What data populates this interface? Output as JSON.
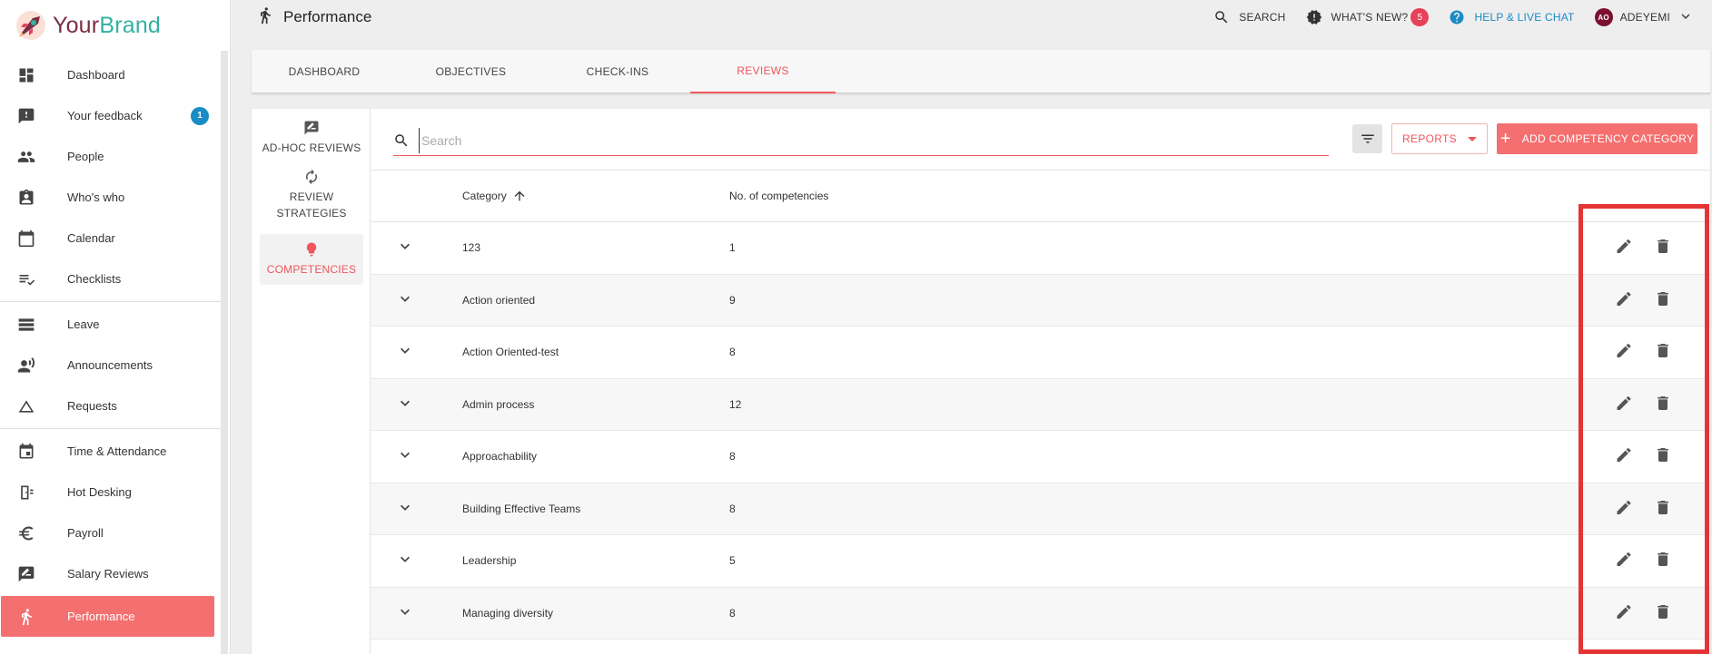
{
  "brand": {
    "name_part1": "Your",
    "name_part2": "Brand"
  },
  "sidebar": {
    "items": [
      {
        "label": "Dashboard",
        "icon": "dashboard-icon"
      },
      {
        "label": "Your feedback",
        "icon": "feedback-icon",
        "badge": "1"
      },
      {
        "label": "People",
        "icon": "people-icon"
      },
      {
        "label": "Who's who",
        "icon": "badge-icon"
      },
      {
        "label": "Calendar",
        "icon": "calendar-icon"
      },
      {
        "label": "Checklists",
        "icon": "checklist-icon"
      },
      {
        "label": "Leave",
        "icon": "leave-icon"
      },
      {
        "label": "Announcements",
        "icon": "announcement-icon"
      },
      {
        "label": "Requests",
        "icon": "triangle-icon"
      },
      {
        "label": "Time & Attendance",
        "icon": "event-icon"
      },
      {
        "label": "Hot Desking",
        "icon": "door-icon"
      },
      {
        "label": "Payroll",
        "icon": "euro-icon"
      },
      {
        "label": "Salary Reviews",
        "icon": "rate-review-icon"
      },
      {
        "label": "Performance",
        "icon": "running-icon",
        "active": true
      }
    ]
  },
  "header": {
    "title": "Performance",
    "search_label": "SEARCH",
    "whats_new_label": "WHAT'S NEW?",
    "whats_new_count": "5",
    "help_label": "HELP & LIVE CHAT",
    "user_initials": "AO",
    "user_name": "ADEYEMI"
  },
  "tabs": [
    {
      "label": "DASHBOARD"
    },
    {
      "label": "OBJECTIVES"
    },
    {
      "label": "CHECK-INS"
    },
    {
      "label": "REVIEWS",
      "active": true
    }
  ],
  "subnav": [
    {
      "label": "AD-HOC REVIEWS"
    },
    {
      "label": "REVIEW STRATEGIES"
    },
    {
      "label": "COMPETENCIES",
      "active": true
    }
  ],
  "toolbar": {
    "search_placeholder": "Search",
    "reports_label": "REPORTS",
    "add_label": "ADD COMPETENCY CATEGORY"
  },
  "table": {
    "col_category": "Category",
    "col_count": "No. of competencies",
    "rows": [
      {
        "category": "123",
        "count": "1"
      },
      {
        "category": "Action oriented",
        "count": "9"
      },
      {
        "category": "Action Oriented-test",
        "count": "8"
      },
      {
        "category": "Admin process",
        "count": "12"
      },
      {
        "category": "Approachability",
        "count": "8"
      },
      {
        "category": "Building Effective Teams",
        "count": "8"
      },
      {
        "category": "Leadership",
        "count": "5"
      },
      {
        "category": "Managing diversity",
        "count": "8"
      }
    ]
  },
  "colors": {
    "accent": "#f0565d",
    "brand_dark": "#7b2d43",
    "brand_teal": "#32b1a1",
    "link_blue": "#1a8bc4",
    "highlight_box": "#e53434"
  }
}
